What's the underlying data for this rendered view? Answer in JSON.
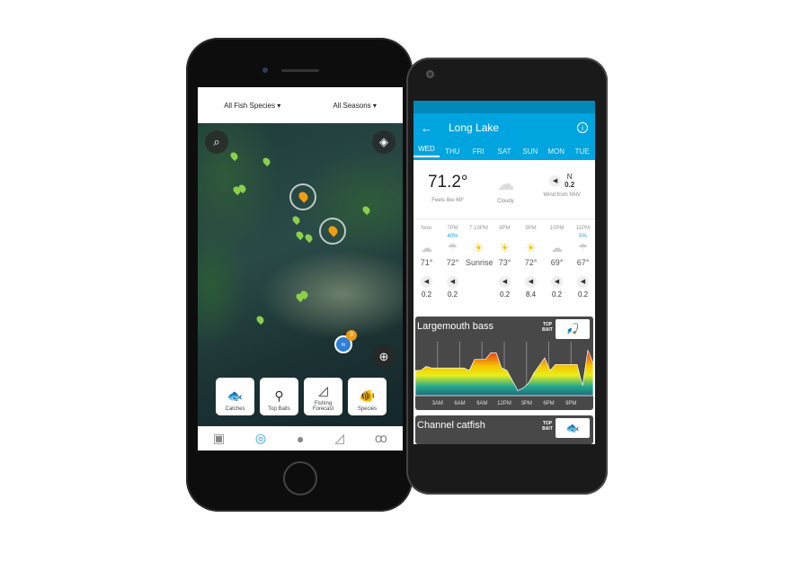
{
  "left_phone": {
    "filters": {
      "species": "All Fish Species ▾",
      "seasons": "All Seasons ▾"
    },
    "map": {
      "cluster_count": "3",
      "icons": {
        "search": "search-icon",
        "layers": "layers-icon",
        "locate": "crosshair-icon"
      }
    },
    "tiles": [
      {
        "label": "Catches",
        "icon": "fish-icon"
      },
      {
        "label": "Top Baits",
        "icon": "lure-icon"
      },
      {
        "label": "Fishing Forecast",
        "icon": "chart-icon"
      },
      {
        "label": "Species",
        "icon": "fishes-icon"
      }
    ],
    "tabbar": [
      "feed-icon",
      "compass-icon",
      "profile-icon",
      "chart-icon",
      "binoculars-icon"
    ],
    "accent": "#1ea0e6"
  },
  "right_phone": {
    "title": "Long Lake",
    "days": [
      "WED",
      "THU",
      "FRI",
      "SAT",
      "SUN",
      "MON",
      "TUE"
    ],
    "selected_day": "WED",
    "current": {
      "temp": "71.2°",
      "feels": "Feels like 69°",
      "condition": "Cloudy",
      "wind_dir": "N",
      "wind_speed": "0.2",
      "wind_label": "Wind from NNV"
    },
    "hours": [
      {
        "time": "Now",
        "precip": "",
        "icon": "☁",
        "temp": "71°",
        "wind": "0.2"
      },
      {
        "time": "7PM",
        "precip": "40%",
        "icon": "☂",
        "temp": "72°",
        "wind": "0.2"
      },
      {
        "time": "7:13PM",
        "precip": "",
        "icon": "☀",
        "temp": "Sunrise",
        "wind": ""
      },
      {
        "time": "8PM",
        "precip": "",
        "icon": "☀",
        "temp": "73°",
        "wind": "0.2"
      },
      {
        "time": "9PM",
        "precip": "",
        "icon": "☀",
        "temp": "72°",
        "wind": "8.4"
      },
      {
        "time": "10PM",
        "precip": "",
        "icon": "☁",
        "temp": "69°",
        "wind": "0.2"
      },
      {
        "time": "11PM",
        "precip": "5%",
        "icon": "☂",
        "temp": "67°",
        "wind": "0.2"
      }
    ],
    "cards": [
      {
        "species": "Largemouth bass",
        "top_bait": "TOP BAIT",
        "ticks": [
          "3AM",
          "6AM",
          "9AM",
          "12PM",
          "3PM",
          "6PM",
          "9PM"
        ],
        "activity": [
          0.5,
          0.5,
          0.58,
          0.55,
          0.55,
          0.55,
          0.55,
          0.55,
          0.55,
          0.55,
          0.5,
          0.72,
          0.72,
          0.72,
          0.85,
          0.85,
          0.55,
          0.5,
          0.3,
          0.1,
          0.15,
          0.25,
          0.45,
          0.6,
          0.75,
          0.5,
          0.62,
          0.62,
          0.62,
          0.62,
          0.62,
          0.2,
          0.9,
          0.65
        ]
      },
      {
        "species": "Channel catfish",
        "top_bait": "TOP BAIT"
      }
    ],
    "accent": "#00a5df"
  }
}
